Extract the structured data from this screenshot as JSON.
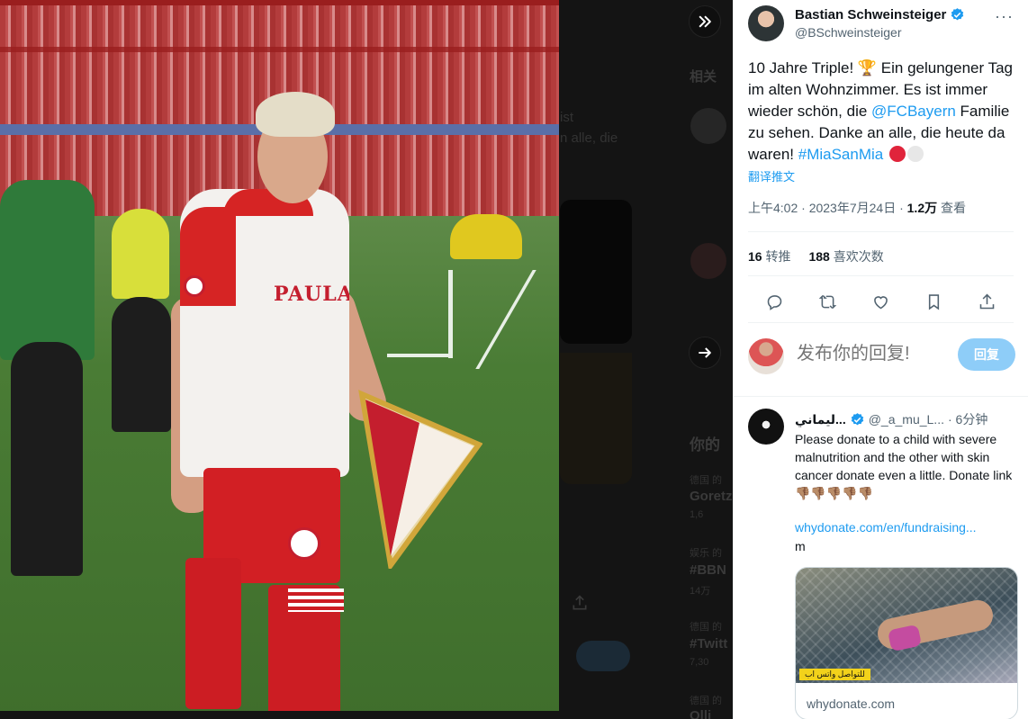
{
  "background_page": {
    "heading_related": "相关",
    "snippet_line1": "ist",
    "snippet_line2": "n alle, die",
    "heading_trending": "你的",
    "trend1_meta": "德国 的",
    "trend1_title": "Goretz",
    "trend1_count": "1,6",
    "trend2_meta": "娱乐 的",
    "trend2_title": "#BBN",
    "trend2_count": "14万",
    "trend3_meta": "德国 的",
    "trend3_title": "#Twitt",
    "trend3_count": "7,30",
    "trend4_meta": "德国 的",
    "trend4_title": "Olli"
  },
  "viewer": {
    "collapse_icon": "double-chevron-right-icon",
    "next_icon": "arrow-right-icon"
  },
  "tweet": {
    "author_name": "Bastian Schweinsteiger",
    "author_handle": "@BSchweinsteiger",
    "more_label": "···",
    "text_part1": "10 Jahre Triple! 🏆 Ein gelungener Tag im alten Wohnzimmer. Es ist immer wieder schön, die ",
    "mention": "@FCBayern",
    "text_part2": " Familie zu sehen. Danke an alle, die heute da waren! ",
    "hashtag": "#MiaSanMia",
    "translate_label": "翻译推文",
    "time": "上午4:02 · 2023年7月24日 · ",
    "views_count": "1.2万",
    "views_label": " 查看",
    "retweets_count": "16",
    "retweets_label": " 转推",
    "likes_count": "188",
    "likes_label": " 喜欢次数",
    "colors": {
      "red_dot": "#e0243b",
      "white_dot": "#e7e7e7",
      "accent": "#1d9bf0"
    }
  },
  "compose": {
    "placeholder": "发布你的回复!",
    "reply_button": "回复"
  },
  "reply": {
    "name": "ليماني...",
    "handle": "@_a_mu_L...",
    "time": "· 6分钟",
    "text": "Please donate to a child with severe malnutrition and the other with skin cancer donate even a little. Donate link👎🏽👎🏽👎🏽👎🏽👎🏽",
    "link": "whydonate.com/en/fundraising...",
    "link_tail": "m",
    "card_tag": "للتواصل واتس اب",
    "card_domain": "whydonate.com"
  }
}
